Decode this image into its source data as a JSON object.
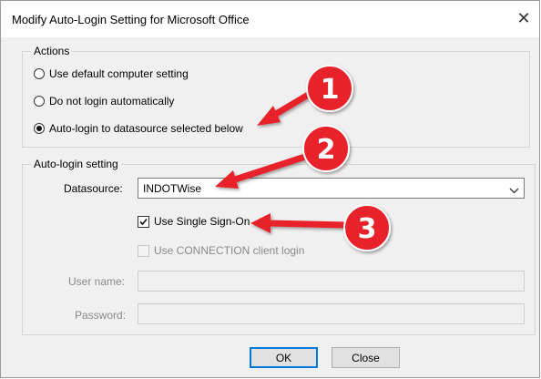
{
  "dialog": {
    "title": "Modify Auto-Login Setting for Microsoft Office",
    "close_glyph": "✕"
  },
  "actions": {
    "group_label": "Actions",
    "options": [
      {
        "label": "Use default computer setting",
        "checked": false
      },
      {
        "label": "Do not login automatically",
        "checked": false
      },
      {
        "label": "Auto-login to datasource selected below",
        "checked": true
      }
    ]
  },
  "auto_login": {
    "group_label": "Auto-login setting",
    "datasource_label": "Datasource:",
    "datasource_value": "INDOTWise",
    "sso_label": "Use Single Sign-On",
    "sso_checked": true,
    "connection_label": "Use CONNECTION client login",
    "connection_checked": false,
    "username_label": "User name:",
    "username_value": "",
    "password_label": "Password:",
    "password_value": ""
  },
  "buttons": {
    "ok": "OK",
    "close": "Close"
  },
  "callouts": {
    "colors": {
      "arrow": "#e8242a",
      "badge": "#e8242a",
      "badge_text": "#ffffff"
    },
    "items": [
      "1",
      "2",
      "3"
    ]
  }
}
